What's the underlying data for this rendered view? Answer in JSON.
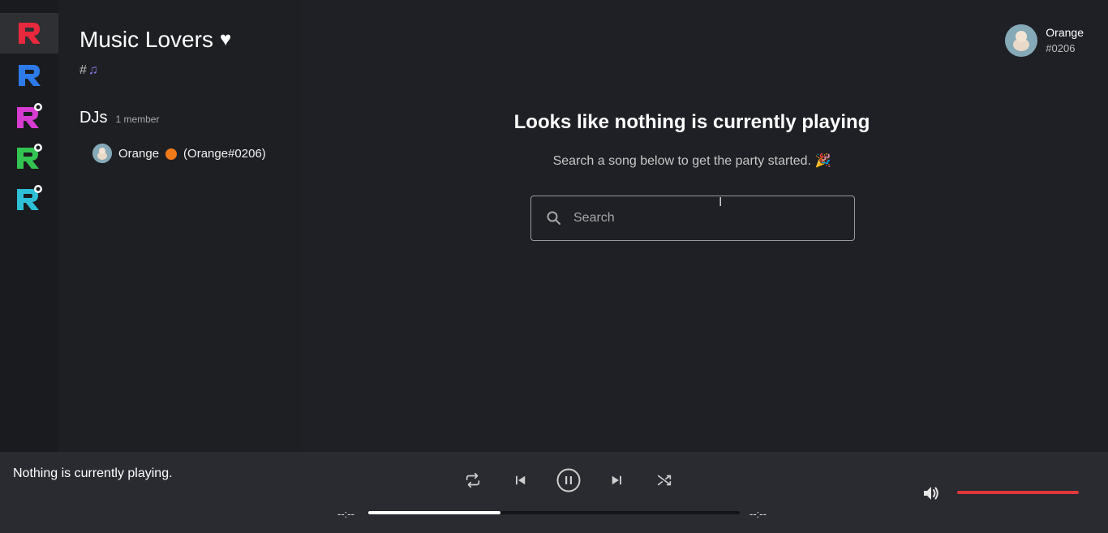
{
  "rail": {
    "servers": [
      {
        "name": "server-red",
        "color": "#e8283c",
        "badge": false
      },
      {
        "name": "server-blue",
        "color": "#2d7be8",
        "badge": false
      },
      {
        "name": "server-magenta",
        "color": "#d63ccf",
        "badge": true
      },
      {
        "name": "server-green",
        "color": "#33c451",
        "badge": true
      },
      {
        "name": "server-cyan",
        "color": "#2ec0d6",
        "badge": true
      }
    ]
  },
  "sidebar": {
    "server_title": "Music Lovers",
    "heart": "♥",
    "channel_hash": "#",
    "channel_icon": "♫",
    "role": {
      "name": "DJs",
      "count": "1 member"
    },
    "members": [
      {
        "name": "Orange",
        "tag": "(Orange#0206)",
        "emoji": "orange"
      }
    ]
  },
  "user": {
    "name": "Orange",
    "tag": "#0206"
  },
  "main": {
    "headline": "Looks like nothing is currently playing",
    "subtext": "Search a song below to get the party started. 🎉",
    "search_placeholder": "Search"
  },
  "player": {
    "now_playing": "Nothing is currently playing.",
    "time_elapsed": "--:--",
    "time_total": "--:--",
    "progress": 0.355,
    "volume": 1.0,
    "colors": {
      "progress": "#ffffff",
      "volume": "#e0383c"
    }
  }
}
